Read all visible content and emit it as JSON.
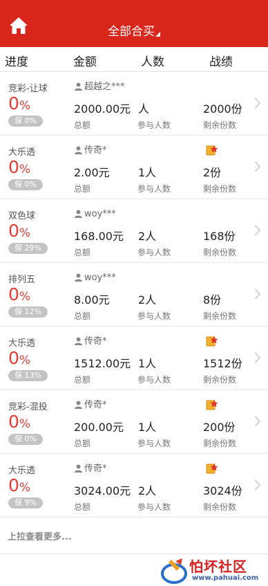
{
  "header": {
    "title": "全部合买",
    "home_icon": "home-icon"
  },
  "columns": {
    "progress": "进度",
    "amount": "金额",
    "people": "人数",
    "record": "战绩"
  },
  "labels": {
    "amount": "总额",
    "people": "参与人数",
    "remaining": "剩余份数"
  },
  "rows": [
    {
      "game": "竞彩-让球",
      "progress": "0",
      "unit": "%",
      "guarantee": "保 0%",
      "user": "超越之***",
      "amount": "2000.00元",
      "people": "人",
      "remaining": "2000份",
      "medal": false
    },
    {
      "game": "大乐透",
      "progress": "0",
      "unit": "%",
      "guarantee": "保 0%",
      "user": "传奇*",
      "amount": "2.00元",
      "people": "1人",
      "remaining": "2份",
      "medal": true
    },
    {
      "game": "双色球",
      "progress": "0",
      "unit": "%",
      "guarantee": "保 29%",
      "user": "woy***",
      "amount": "168.00元",
      "people": "2人",
      "remaining": "168份",
      "medal": false
    },
    {
      "game": "排列五",
      "progress": "0",
      "unit": "%",
      "guarantee": "保 12%",
      "user": "woy***",
      "amount": "8.00元",
      "people": "2人",
      "remaining": "8份",
      "medal": false
    },
    {
      "game": "大乐透",
      "progress": "0",
      "unit": "%",
      "guarantee": "保 13%",
      "user": "传奇*",
      "amount": "1512.00元",
      "people": "1人",
      "remaining": "1512份",
      "medal": true
    },
    {
      "game": "竞彩-混投",
      "progress": "0",
      "unit": "%",
      "guarantee": "保 0%",
      "user": "传奇*",
      "amount": "200.00元",
      "people": "1人",
      "remaining": "200份",
      "medal": true
    },
    {
      "game": "大乐透",
      "progress": "0",
      "unit": "%",
      "guarantee": "保 9%",
      "user": "传奇*",
      "amount": "3024.00元",
      "people": "2人",
      "remaining": "3024份",
      "medal": true
    }
  ],
  "load_more": "上拉查看更多...",
  "watermark": {
    "title": "怕坏社区",
    "url": "www.pahuai.com"
  },
  "colors": {
    "brand_red": "#d9261c",
    "progress_red": "#e43a35",
    "badge_gray": "#c4c4c4"
  }
}
